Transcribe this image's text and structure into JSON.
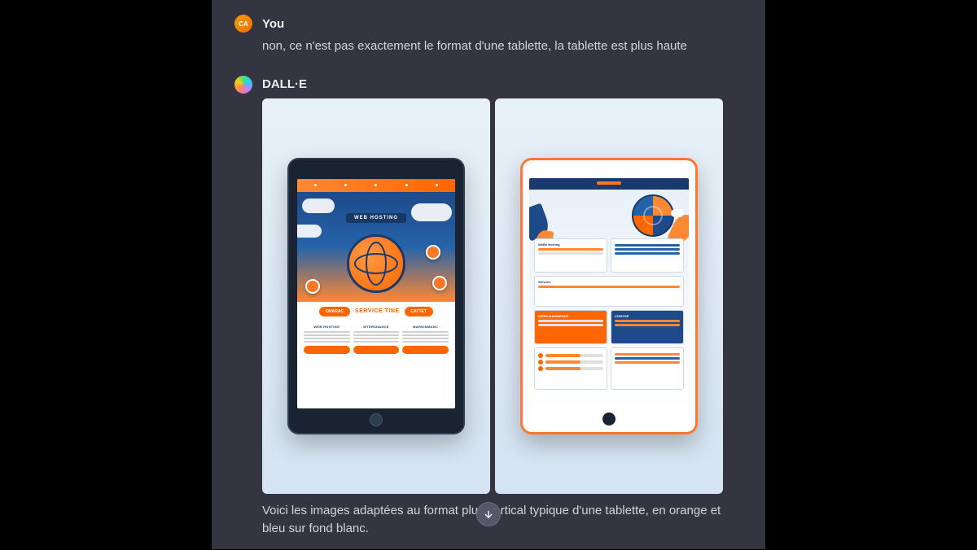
{
  "user_message": {
    "sender": "You",
    "avatar_initials": "CA",
    "text": "non, ce n'est pas exactement le format d'une tablette, la tablette est plus haute"
  },
  "assistant_message": {
    "sender": "DALL·E",
    "response_text": "Voici les images adaptées au format plus vertical typique d'une tablette, en orange et bleu sur fond blanc.",
    "images": {
      "image1": {
        "hero_badge": "WEB HOSTING",
        "service_title": "SERVICE TINE",
        "cta_left": "ONARAC",
        "cta_right": "CATTET",
        "col1_header": "WEB HOSTING",
        "col2_header": "WTERSNANCE",
        "col3_header": "MARNINMANC"
      },
      "image2": {
        "panel_label_1": "WoBe Horting",
        "panel_label_2": "Stevoes",
        "panel_label_3": "WEES MAINNENCE",
        "panel_label_4": "CONYOE"
      }
    }
  },
  "colors": {
    "orange": "#ff6600",
    "blue": "#1e4a8a",
    "bg_dark": "#343541"
  }
}
